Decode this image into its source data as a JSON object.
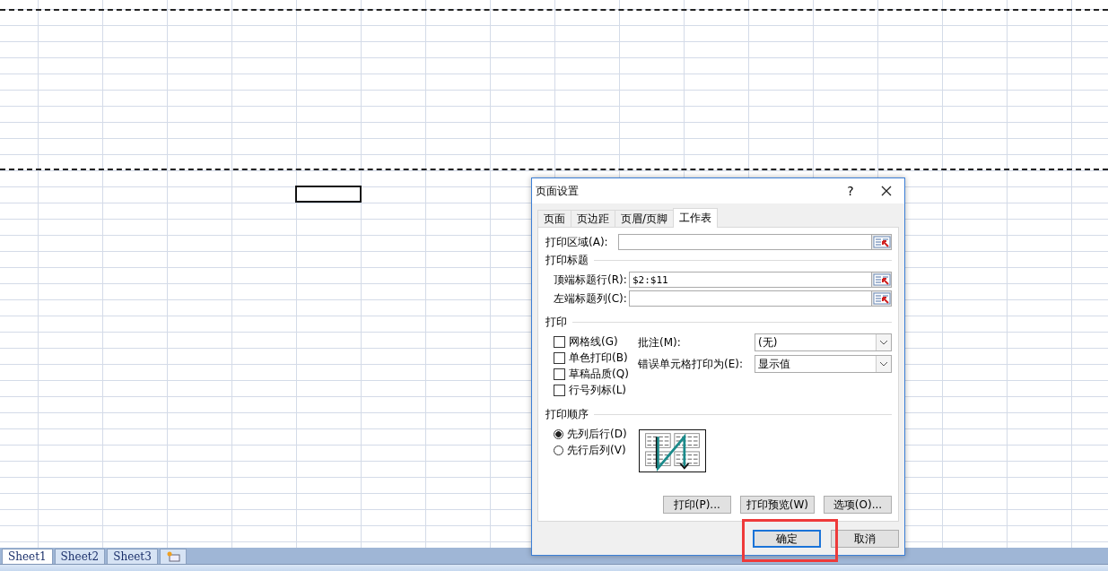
{
  "dialog": {
    "title": "页面设置",
    "help": "?",
    "tabs": [
      {
        "label": "页面",
        "selected": false
      },
      {
        "label": "页边距",
        "selected": false
      },
      {
        "label": "页眉/页脚",
        "selected": false
      },
      {
        "label": "工作表",
        "selected": true
      }
    ],
    "print_area": {
      "label": "打印区域(A):"
    },
    "print_titles": {
      "heading": "打印标题",
      "rows_label": "顶端标题行(R):",
      "rows_value": "$2:$11",
      "columns_label": "左端标题列(C):"
    },
    "print": {
      "heading": "打印",
      "options": [
        {
          "label": "网格线(G)",
          "checked": false
        },
        {
          "label": "单色打印(B)",
          "checked": false
        },
        {
          "label": "草稿品质(Q)",
          "checked": false
        },
        {
          "label": "行号列标(L)",
          "checked": false
        }
      ],
      "comments": {
        "label": "批注(M):",
        "value": "(无)"
      },
      "errors": {
        "label": "错误单元格打印为(E):",
        "value": "显示值"
      }
    },
    "page_order": {
      "heading": "打印顺序",
      "options": [
        {
          "label": "先列后行(D)",
          "selected": true
        },
        {
          "label": "先行后列(V)",
          "selected": false
        }
      ]
    },
    "buttons": [
      "打印(P)...",
      "打印预览(W)",
      "选项(O)..."
    ],
    "footer_buttons": [
      {
        "label": "确定",
        "kind": "default"
      },
      {
        "label": "取消",
        "kind": "normal"
      }
    ]
  },
  "sheet_tabs": [
    {
      "label": "Sheet1",
      "selected": true
    },
    {
      "label": "Sheet2",
      "selected": false
    },
    {
      "label": "Sheet3",
      "selected": false
    }
  ]
}
